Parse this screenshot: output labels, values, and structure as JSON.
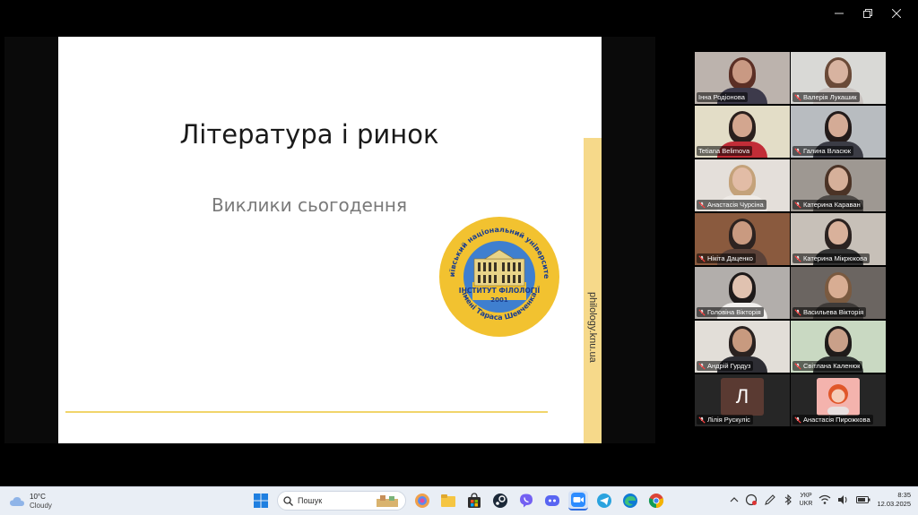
{
  "window": {
    "controls": [
      "minimize-icon",
      "restore-icon",
      "close-icon"
    ]
  },
  "slide": {
    "title": "Література і ринок",
    "subtitle": "Виклики сьогодення",
    "url": "philology.knu.ua",
    "seal": {
      "arc_top": "Київський національний університет",
      "institute": "ІНСТИТУТ ФІЛОЛОГІЇ",
      "year": "2001",
      "arc_bottom": "імені Тараса Шевченка",
      "colors": {
        "ring": "#f2c230",
        "sky": "#3f7fcf",
        "building": "#e8d488"
      }
    }
  },
  "participants": [
    {
      "name": "Інна Родіонова",
      "muted": false,
      "active": false,
      "kind": "video",
      "bg": "#bcb3ad",
      "skin": "#c99983",
      "hair": "#5b2f25",
      "shirt": "#3d3a4b"
    },
    {
      "name": "Валерія Лукашик",
      "muted": true,
      "active": false,
      "kind": "video",
      "bg": "#d9d9d6",
      "skin": "#d8b3a0",
      "hair": "#6a4a38",
      "shirt": "#c9c2bf"
    },
    {
      "name": "Tetiana Belimova",
      "muted": false,
      "active": true,
      "kind": "video",
      "bg": "#e3ddc7",
      "skin": "#d3a68f",
      "hair": "#2a1f1d",
      "shirt": "#c22d37"
    },
    {
      "name": "Галина Власюк",
      "muted": true,
      "active": false,
      "kind": "video",
      "bg": "#b8bcc0",
      "skin": "#d4ab96",
      "hair": "#231b1a",
      "shirt": "#3b3c45"
    },
    {
      "name": "Анастасія Чурсіна",
      "muted": true,
      "active": false,
      "kind": "video",
      "bg": "#e4dfda",
      "skin": "#e2bca6",
      "hair": "#c4a27a",
      "shirt": "#eeeae6"
    },
    {
      "name": "Катерина Караван",
      "muted": true,
      "active": false,
      "kind": "video",
      "bg": "#9e9892",
      "skin": "#d6b09a",
      "hair": "#4b3326",
      "shirt": "#4e4a47"
    },
    {
      "name": "Нікіта Даценко",
      "muted": true,
      "active": false,
      "kind": "video",
      "bg": "#8a5a3e",
      "skin": "#c99a80",
      "hair": "#2d2320",
      "shirt": "#5a4138"
    },
    {
      "name": "Катерина Мікрюкова",
      "muted": true,
      "active": false,
      "kind": "video",
      "bg": "#c7c0b8",
      "skin": "#d9b19b",
      "hair": "#2b2220",
      "shirt": "#333"
    },
    {
      "name": "Головіна Вікторія",
      "muted": true,
      "active": false,
      "kind": "video",
      "bg": "#b2aeab",
      "skin": "#e0c2b0",
      "hair": "#1e1a1a",
      "shirt": "#f2f0ee"
    },
    {
      "name": "Васильева Вікторія",
      "muted": true,
      "active": false,
      "kind": "video",
      "bg": "#6b6561",
      "skin": "#d8ad93",
      "hair": "#7a5a40",
      "shirt": "#3e3a38"
    },
    {
      "name": "Андрій Гурдуз",
      "muted": true,
      "active": false,
      "kind": "video",
      "bg": "#e2ded8",
      "skin": "#c89a7f",
      "hair": "#2a2220",
      "shirt": "#2d2d33"
    },
    {
      "name": "Світлана Каленюк",
      "muted": true,
      "active": false,
      "kind": "video",
      "bg": "#c9d9c2",
      "skin": "#c9a089",
      "hair": "#1f1b1a",
      "shirt": "#303332"
    },
    {
      "name": "Лілія Рускуліс",
      "muted": true,
      "active": false,
      "kind": "initial",
      "initial": "Л"
    },
    {
      "name": "Анастасія Пирожкова",
      "muted": true,
      "active": false,
      "kind": "avatar"
    }
  ],
  "taskbar": {
    "weather": {
      "temp": "10°C",
      "condition": "Cloudy"
    },
    "search_placeholder": "Пошук",
    "lang_top": "УКР",
    "lang_bottom": "UKR",
    "time": "8:35",
    "date": "12.03.2025",
    "apps": [
      "windows-start-icon",
      "search-icon",
      "copilot-icon",
      "file-explorer-icon",
      "store-icon",
      "steam-icon",
      "viber-icon",
      "discord-icon",
      "zoom-icon",
      "telegram-icon",
      "edge-icon",
      "chrome-icon"
    ]
  }
}
